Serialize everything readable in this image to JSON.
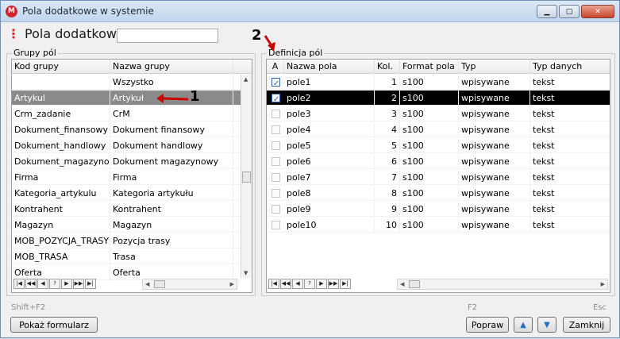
{
  "window": {
    "title": "Pola dodatkowe w  systemie",
    "app_icon": "M"
  },
  "header": {
    "title": "Pola dodatkowe",
    "search_value": ""
  },
  "groups": {
    "label": "Grupy pól",
    "columns": [
      "Kod grupy",
      "Nazwa grupy"
    ],
    "rows": [
      [
        "",
        "Wszystko"
      ],
      [
        "Artykul",
        "Artykuł"
      ],
      [
        "Crm_zadanie",
        "CrM"
      ],
      [
        "Dokument_finansowy",
        "Dokument finansowy"
      ],
      [
        "Dokument_handlowy",
        "Dokument handlowy"
      ],
      [
        "Dokument_magazynowy",
        "Dokument magazynowy"
      ],
      [
        "Firma",
        "Firma"
      ],
      [
        "Kategoria_artykulu",
        "Kategoria artykułu"
      ],
      [
        "Kontrahent",
        "Kontrahent"
      ],
      [
        "Magazyn",
        "Magazyn"
      ],
      [
        "MOB_POZYCJA_TRASY",
        "Pozycja trasy"
      ],
      [
        "MOB_TRASA",
        "Trasa"
      ],
      [
        "Oferta",
        "Oferta"
      ]
    ],
    "selected_index": 1
  },
  "fields": {
    "label": "Definicja pól",
    "columns": [
      "A",
      "Nazwa pola",
      "Kol.",
      "Format pola",
      "Typ",
      "Typ danych"
    ],
    "rows": [
      {
        "active": true,
        "name": "pole1",
        "col": "1",
        "format": "s100",
        "type": "wpisywane",
        "datatype": "tekst"
      },
      {
        "active": true,
        "name": "pole2",
        "col": "2",
        "format": "s100",
        "type": "wpisywane",
        "datatype": "tekst"
      },
      {
        "active": false,
        "name": "pole3",
        "col": "3",
        "format": "s100",
        "type": "wpisywane",
        "datatype": "tekst"
      },
      {
        "active": false,
        "name": "pole4",
        "col": "4",
        "format": "s100",
        "type": "wpisywane",
        "datatype": "tekst"
      },
      {
        "active": false,
        "name": "pole5",
        "col": "5",
        "format": "s100",
        "type": "wpisywane",
        "datatype": "tekst"
      },
      {
        "active": false,
        "name": "pole6",
        "col": "6",
        "format": "s100",
        "type": "wpisywane",
        "datatype": "tekst"
      },
      {
        "active": false,
        "name": "pole7",
        "col": "7",
        "format": "s100",
        "type": "wpisywane",
        "datatype": "tekst"
      },
      {
        "active": false,
        "name": "pole8",
        "col": "8",
        "format": "s100",
        "type": "wpisywane",
        "datatype": "tekst"
      },
      {
        "active": false,
        "name": "pole9",
        "col": "9",
        "format": "s100",
        "type": "wpisywane",
        "datatype": "tekst"
      },
      {
        "active": false,
        "name": "pole10",
        "col": "10",
        "format": "s100",
        "type": "wpisywane",
        "datatype": "tekst"
      }
    ],
    "selected_index": 1
  },
  "navigator": [
    "|◀",
    "◀◀",
    "◀",
    "?",
    "▶",
    "▶▶",
    "▶|"
  ],
  "footer": {
    "shortcut_left": "Shift+F2",
    "show_form": "Pokaż formularz",
    "shortcut_f2": "F2",
    "popraw": "Popraw",
    "shortcut_esc": "Esc",
    "zamknij": "Zamknij"
  },
  "annotations": [
    "1",
    "2"
  ]
}
